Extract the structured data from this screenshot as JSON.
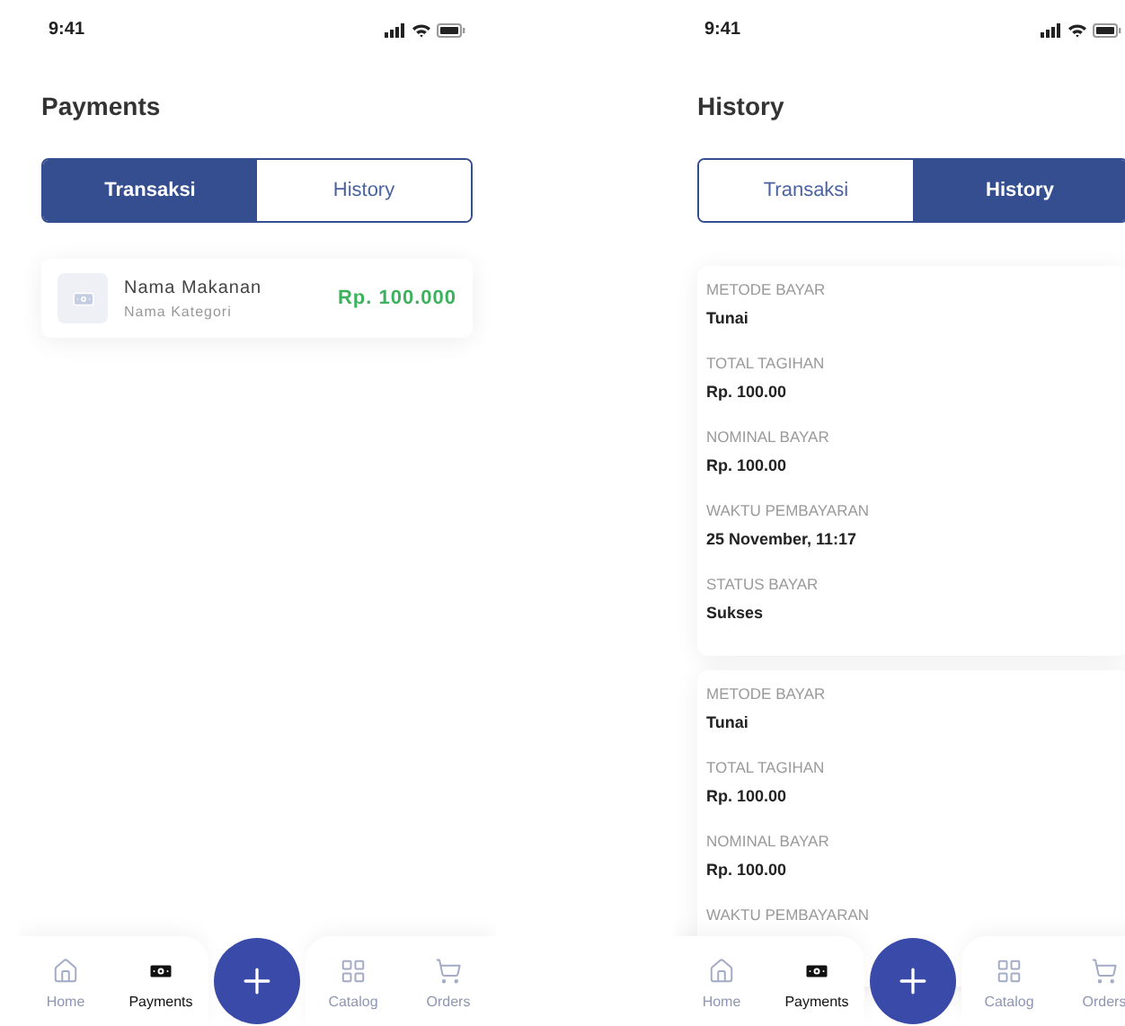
{
  "screens": [
    {
      "status_bar": {
        "time": "9:41"
      },
      "title": "Payments",
      "tabs": [
        {
          "label": "Transaksi",
          "selected": true
        },
        {
          "label": "History",
          "selected": false
        }
      ],
      "transactions": [
        {
          "name": "Nama Makanan",
          "category": "Nama Kategori",
          "amount": "Rp. 100.000"
        }
      ],
      "nav": {
        "items": [
          {
            "kind": "home",
            "label": "Home",
            "selected": false
          },
          {
            "kind": "payments",
            "label": "Payments",
            "selected": true
          },
          {
            "kind": "add"
          },
          {
            "kind": "catalog",
            "label": "Catalog",
            "selected": false
          },
          {
            "kind": "orders",
            "label": "Orders",
            "selected": false
          }
        ]
      }
    },
    {
      "status_bar": {
        "time": "9:41"
      },
      "title": "History",
      "tabs": [
        {
          "label": "Transaksi",
          "selected": false
        },
        {
          "label": "History",
          "selected": true
        }
      ],
      "records": [
        {
          "fields": [
            {
              "label": "METODE BAYAR",
              "value": "Tunai"
            },
            {
              "label": "TOTAL TAGIHAN",
              "value": "Rp. 100.00"
            },
            {
              "label": "NOMINAL BAYAR",
              "value": "Rp. 100.00"
            },
            {
              "label": "WAKTU PEMBAYARAN",
              "value": "25 November, 11:17"
            },
            {
              "label": "STATUS BAYAR",
              "value": "Sukses"
            }
          ]
        },
        {
          "fields": [
            {
              "label": "METODE BAYAR",
              "value": "Tunai"
            },
            {
              "label": "TOTAL TAGIHAN",
              "value": "Rp. 100.00"
            },
            {
              "label": "NOMINAL BAYAR",
              "value": "Rp. 100.00"
            },
            {
              "label": "WAKTU PEMBAYARAN"
            }
          ]
        }
      ],
      "nav": {
        "items": [
          {
            "kind": "home",
            "label": "Home",
            "selected": false
          },
          {
            "kind": "payments",
            "label": "Payments",
            "selected": true
          },
          {
            "kind": "add"
          },
          {
            "kind": "catalog",
            "label": "Catalog",
            "selected": false
          },
          {
            "kind": "orders",
            "label": "Orders",
            "selected": false
          }
        ]
      }
    }
  ]
}
